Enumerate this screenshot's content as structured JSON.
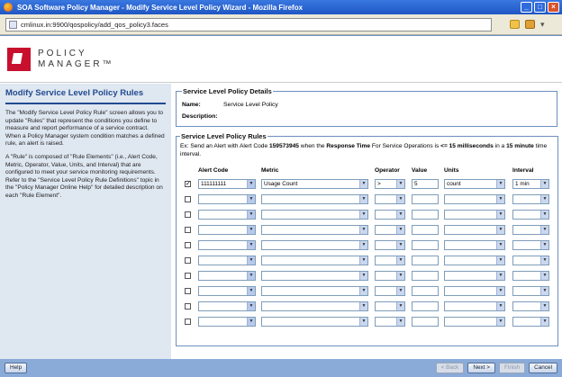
{
  "window": {
    "title": "SOA Software Policy Manager - Modify Service Level Policy Wizard - Mozilla Firefox",
    "min": "_",
    "max": "□",
    "close": "×"
  },
  "browser": {
    "url": "cmlinux.in:9900/qospolicy/add_qos_policy3.faces"
  },
  "logo": {
    "line1": "POLICY",
    "line2": "MANAGER™"
  },
  "left": {
    "heading": "Modify Service Level Policy Rules",
    "p1": "The \"Modify Service Level Policy Rule\" screen allows you to update \"Rules\" that represent the conditions you define to measure and report performance of a service contract. When a Policy Manager system condition matches a defined rule, an alert is raised.",
    "p2": "A \"Rule\" is composed of \"Rule Elements\" (i.e., Alert Code, Metric, Operator, Value, Units, and Interval) that are configured to meet your service monitoring requirements. Refer to the \"Service Level Policy Rule Definitions\" topic in the \"Policy Manager Online Help\" for detailed description on each \"Rule Element\"."
  },
  "details": {
    "legend": "Service Level Policy Details",
    "name_label": "Name:",
    "name_value": "Service Level Policy",
    "desc_label": "Description:"
  },
  "rules": {
    "legend": "Service Level Policy Rules",
    "ex1": "Ex: Send an Alert with Alert Code ",
    "ex_code": "159573945",
    "ex2": " when the ",
    "ex_metric": "Response Time",
    "ex3": " For Service Operations is ",
    "ex_cond": "<= 15 milliseconds",
    "ex4": " in a ",
    "ex_int": "15 minute",
    "ex5": " time interval.",
    "headers": {
      "code": "Alert Code",
      "metric": "Metric",
      "op": "Operator",
      "val": "Value",
      "units": "Units",
      "int": "Interval"
    },
    "row1": {
      "check": "✓",
      "code": "111111111",
      "metric": "Usage Count",
      "op": ">",
      "val": "5",
      "units": "count",
      "int": "1 min"
    }
  },
  "footer": {
    "help": "Help",
    "back": "< Back",
    "next": "Next >",
    "finish": "Finish",
    "cancel": "Cancel"
  }
}
